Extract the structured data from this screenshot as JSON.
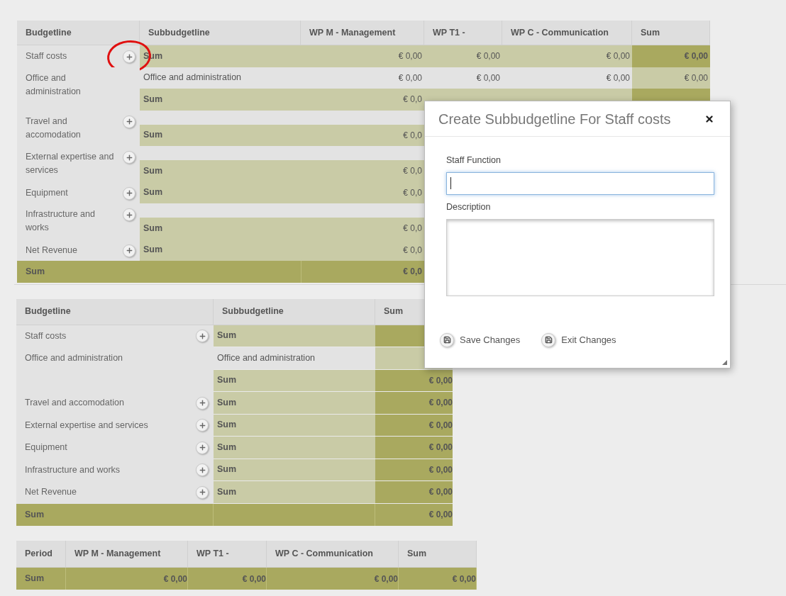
{
  "budget_table": {
    "columns": [
      "Budgetline",
      "Subbudgetline",
      "WP M - Management",
      "WP T1 -",
      "WP C - Communication",
      "Sum"
    ],
    "groups": [
      {
        "budgetline": "Staff costs",
        "add_button": true,
        "highlighted": true,
        "rows": [
          {
            "kind": "sum",
            "label": "Sum",
            "values": [
              "€ 0,00",
              "€ 0,00",
              "€ 0,00",
              "€ 0,00"
            ]
          }
        ]
      },
      {
        "budgetline": "Office and administration",
        "add_button": false,
        "highlighted": false,
        "rows": [
          {
            "kind": "item",
            "label": "Office and administration",
            "values": [
              "€ 0,00",
              "€ 0,00",
              "€ 0,00",
              "€ 0,00"
            ]
          },
          {
            "kind": "sum",
            "label": "Sum",
            "values": [
              "€ 0,0"
            ]
          }
        ]
      },
      {
        "budgetline": "Travel and accomodation",
        "add_button": true,
        "highlighted": false,
        "rows": [
          {
            "kind": "blank"
          },
          {
            "kind": "sum",
            "label": "Sum",
            "values": [
              "€ 0,0"
            ]
          }
        ]
      },
      {
        "budgetline": "External expertise and services",
        "add_button": true,
        "highlighted": false,
        "rows": [
          {
            "kind": "blank"
          },
          {
            "kind": "sum",
            "label": "Sum",
            "values": [
              "€ 0,0"
            ]
          }
        ]
      },
      {
        "budgetline": "Equipment",
        "add_button": true,
        "highlighted": false,
        "rows": [
          {
            "kind": "sum",
            "label": "Sum",
            "values": [
              "€ 0,0"
            ]
          }
        ]
      },
      {
        "budgetline": "Infrastructure and works",
        "add_button": true,
        "highlighted": false,
        "rows": [
          {
            "kind": "blank"
          },
          {
            "kind": "sum",
            "label": "Sum",
            "values": [
              "€ 0,0"
            ]
          }
        ]
      },
      {
        "budgetline": "Net Revenue",
        "add_button": true,
        "highlighted": false,
        "rows": [
          {
            "kind": "sum",
            "label": "Sum",
            "values": [
              "€ 0,0"
            ]
          }
        ]
      }
    ],
    "total": {
      "label": "Sum",
      "values": [
        "€ 0,0"
      ]
    }
  },
  "summary_table": {
    "columns": [
      "Budgetline",
      "Subbudgetline",
      "Sum"
    ],
    "rows": [
      {
        "budgetline": "Staff costs",
        "add_button": true,
        "kind": "sum",
        "label": "Sum"
      },
      {
        "budgetline": "Office and administration",
        "add_button": false,
        "kind": "item",
        "label": "Office and administration"
      },
      {
        "add_button": false,
        "kind": "sum",
        "label": "Sum",
        "value": "€ 0,00"
      },
      {
        "budgetline": "Travel and accomodation",
        "add_button": true,
        "kind": "sum",
        "label": "Sum",
        "value": "€ 0,00"
      },
      {
        "budgetline": "External expertise and services",
        "add_button": true,
        "kind": "sum",
        "label": "Sum",
        "value": "€ 0,00"
      },
      {
        "budgetline": "Equipment",
        "add_button": true,
        "kind": "sum",
        "label": "Sum",
        "value": "€ 0,00"
      },
      {
        "budgetline": "Infrastructure and works",
        "add_button": true,
        "kind": "sum",
        "label": "Sum",
        "value": "€ 0,00"
      },
      {
        "budgetline": "Net Revenue",
        "add_button": true,
        "kind": "sum",
        "label": "Sum",
        "value": "€ 0,00"
      }
    ],
    "total": {
      "label": "Sum",
      "value": "€ 0,00"
    }
  },
  "period_table": {
    "columns": [
      "Period",
      "WP M - Management",
      "WP T1 -",
      "WP C - Communication",
      "Sum"
    ],
    "rows": [
      {
        "period": "Sum",
        "values": [
          "€ 0,00",
          "€ 0,00",
          "€ 0,00",
          "€ 0,00"
        ]
      }
    ]
  },
  "dialog": {
    "title": "Create Subbudgetline For Staff costs",
    "fields": [
      {
        "kind": "input",
        "label": "Staff Function",
        "focused": true
      },
      {
        "kind": "textarea",
        "label": "Description",
        "focused": false
      }
    ],
    "buttons": [
      "Save Changes",
      "Exit Changes"
    ]
  }
}
